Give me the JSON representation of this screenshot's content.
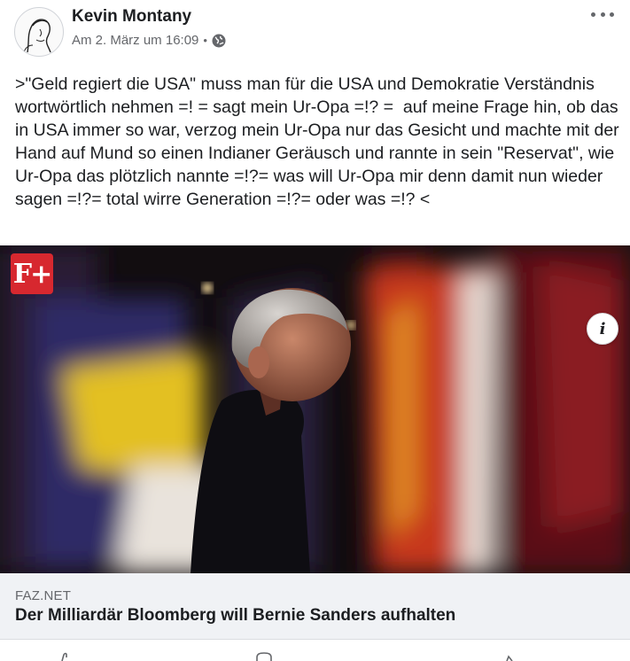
{
  "post": {
    "author": "Kevin Montany",
    "date": "Am 2. März um 16:09",
    "separator": "•",
    "privacy_icon": "globe-icon",
    "text": ">\"Geld regiert die USA\" muss man für die USA und Demokratie Verständnis wortwörtlich nehmen =! = sagt mein Ur-Opa =!? =  auf meine Frage hin, ob das  in USA immer so war, verzog mein Ur-Opa nur das Gesicht und machte mit der Hand auf Mund so einen Indianer Geräusch und rannte in sein \"Reservat\", wie Ur-Opa das plötzlich nannte =!?= was will Ur-Opa mir denn damit nun wieder sagen =!?= total wirre Generation =!?= oder was =!? <"
  },
  "link_preview": {
    "badge": "F+",
    "domain": "FAZ.NET",
    "title": "Der Milliardär Bloomberg will Bernie Sanders aufhalten",
    "info_icon_label": "i"
  },
  "colors": {
    "text_primary": "#1c1e21",
    "text_secondary": "#65676b",
    "link_background": "#f0f2f5",
    "badge_red": "#d7282f"
  }
}
